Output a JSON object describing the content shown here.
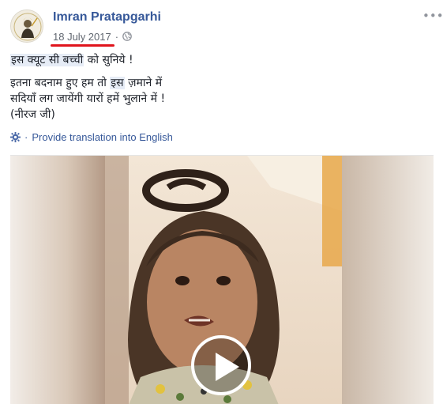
{
  "post": {
    "author": "Imran Pratapgarhi",
    "date": "18 July 2017",
    "separator": "·",
    "menu_label": "•••",
    "privacy_icon": "globe-icon",
    "text_line_1_highlight": "इस क्यूट सी बच्ची",
    "text_line_1_rest": " को सुनिये !",
    "text_line_2_pre": "इतना बदनाम हुए हम तो ",
    "text_line_2_highlight": "इस",
    "text_line_2_post": " ज़माने में",
    "text_line_3": "सदियाँ लग जायेंगी यारों हमें भुलाने में !",
    "text_line_4": "(नीरज जी)",
    "translate_icon": "gear-icon",
    "translate_dot": "·",
    "translate_label": "Provide translation into English",
    "video_play_icon": "play-icon"
  },
  "colors": {
    "link": "#365899",
    "meta": "#616770",
    "highlight_bg": "#e6ecf6",
    "annotation_underline": "#e0141c"
  }
}
